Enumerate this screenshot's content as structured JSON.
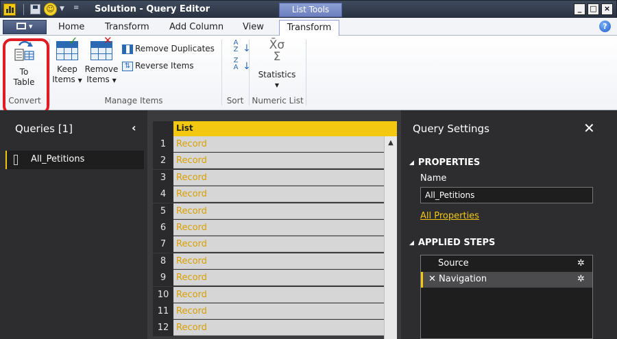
{
  "window": {
    "title": "Solution - Query Editor",
    "context_group": "List Tools",
    "min_label": "_",
    "max_label": "□",
    "close_label": "×"
  },
  "ribbon_tabs": [
    {
      "label": "Home",
      "active": false
    },
    {
      "label": "Transform",
      "active": false
    },
    {
      "label": "Add Column",
      "active": false
    },
    {
      "label": "View",
      "active": false
    },
    {
      "label": "Transform",
      "active": true
    }
  ],
  "ribbon": {
    "to_table": {
      "line1": "To",
      "line2": "Table"
    },
    "keep_items": {
      "line1": "Keep",
      "line2": "Items"
    },
    "remove_items": {
      "line1": "Remove",
      "line2": "Items"
    },
    "remove_duplicates": "Remove Duplicates",
    "reverse_items": "Reverse Items",
    "statistics": "Statistics",
    "groups": {
      "convert": "Convert",
      "manage_items": "Manage Items",
      "sort": "Sort",
      "numeric_list": "Numeric List"
    }
  },
  "queries": {
    "title": "Queries [1]",
    "items": [
      "All_Petitions"
    ]
  },
  "grid": {
    "column_header": "List",
    "rows": [
      {
        "num": "1",
        "value": "Record"
      },
      {
        "num": "2",
        "value": "Record"
      },
      {
        "num": "3",
        "value": "Record"
      },
      {
        "num": "4",
        "value": "Record"
      },
      {
        "num": "5",
        "value": "Record"
      },
      {
        "num": "6",
        "value": "Record"
      },
      {
        "num": "7",
        "value": "Record"
      },
      {
        "num": "8",
        "value": "Record"
      },
      {
        "num": "9",
        "value": "Record"
      },
      {
        "num": "10",
        "value": "Record"
      },
      {
        "num": "11",
        "value": "Record"
      },
      {
        "num": "12",
        "value": "Record"
      }
    ]
  },
  "settings": {
    "title": "Query Settings",
    "properties_title": "PROPERTIES",
    "name_label": "Name",
    "name_value": "All_Petitions",
    "all_properties_link": "All Properties",
    "applied_steps_title": "APPLIED STEPS",
    "steps": [
      {
        "label": "Source",
        "selected": false
      },
      {
        "label": "Navigation",
        "selected": true
      }
    ]
  },
  "colors": {
    "accent_yellow": "#f2c811",
    "panel_dark": "#2d2d30",
    "highlight_red": "#e11b22",
    "record_text": "#d8a000"
  }
}
